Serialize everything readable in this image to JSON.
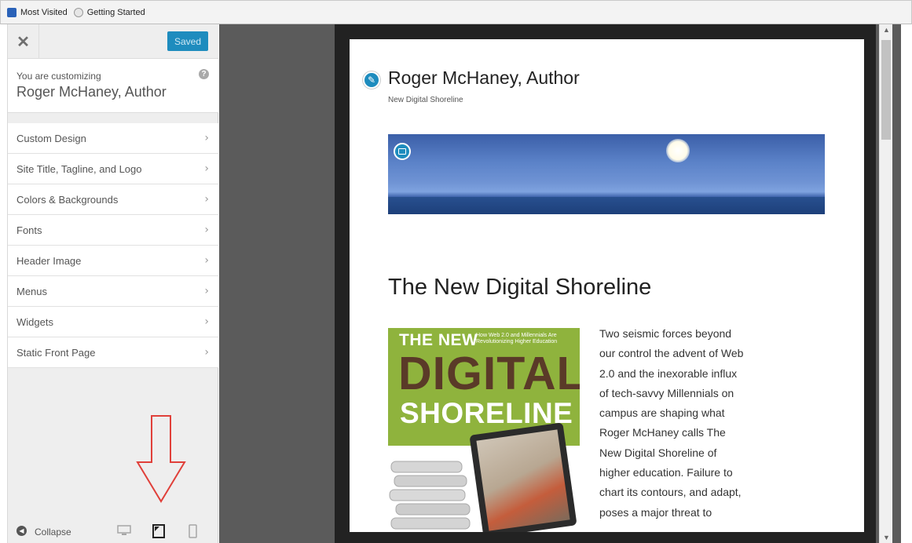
{
  "bookmarks": {
    "items": [
      {
        "label": "Most Visited",
        "icon": "most-visited-icon"
      },
      {
        "label": "Getting Started",
        "icon": "getting-started-icon"
      }
    ]
  },
  "customizer": {
    "close_icon": "close-icon",
    "save_label": "Saved",
    "customizing_label": "You are customizing",
    "site_name": "Roger McHaney, Author",
    "help_icon": "help-icon",
    "sections": [
      {
        "label": "Custom Design"
      },
      {
        "label": "Site Title, Tagline, and Logo"
      },
      {
        "label": "Colors & Backgrounds"
      },
      {
        "label": "Fonts"
      },
      {
        "label": "Header Image"
      },
      {
        "label": "Menus"
      },
      {
        "label": "Widgets"
      },
      {
        "label": "Static Front Page"
      }
    ],
    "collapse_label": "Collapse",
    "devices": [
      "desktop-preview-icon",
      "tablet-preview-icon",
      "mobile-preview-icon"
    ],
    "selected_device": "tablet",
    "accent_color": "#1e8cbe",
    "annotation_arrow_color": "#e0403a"
  },
  "preview": {
    "site_title": "Roger McHaney, Author",
    "tagline": "New Digital Shoreline",
    "post_title": "The New Digital Shoreline",
    "book_cover": {
      "line1": "THE NEW",
      "subtitle": "How Web 2.0 and Millennials Are Revolutionizing Higher Education",
      "line2": "DIGITAL",
      "line3": "SHORELINE"
    },
    "excerpt": "Two seismic forces beyond our control the advent of Web 2.0 and the inexorable influx of tech-savvy Millennials on campus are shaping what Roger McHaney calls The New Digital Shoreline of higher education. Failure to chart its contours, and adapt, poses a major threat to"
  }
}
